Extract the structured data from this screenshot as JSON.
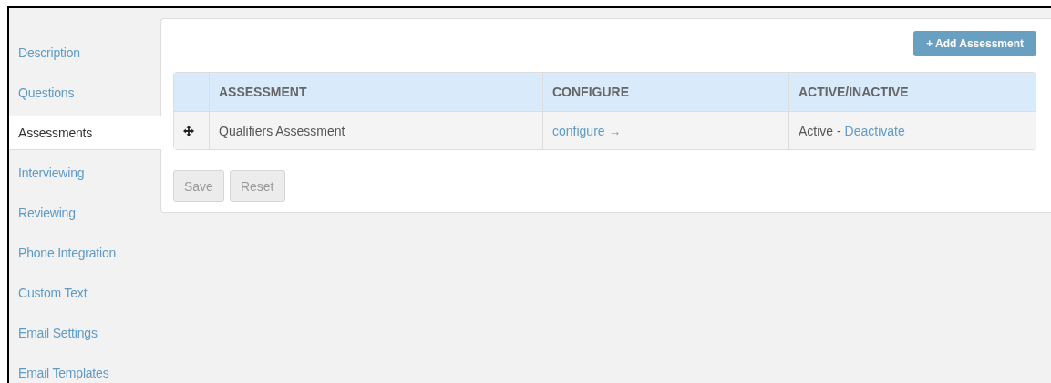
{
  "sidebar": {
    "items": [
      {
        "label": "Description",
        "selected": false
      },
      {
        "label": "Questions",
        "selected": false
      },
      {
        "label": "Assessments",
        "selected": true
      },
      {
        "label": "Interviewing",
        "selected": false
      },
      {
        "label": "Reviewing",
        "selected": false
      },
      {
        "label": "Phone Integration",
        "selected": false
      },
      {
        "label": "Custom Text",
        "selected": false
      },
      {
        "label": "Email Settings",
        "selected": false
      },
      {
        "label": "Email Templates",
        "selected": false
      }
    ]
  },
  "add_button": "+ Add Assessment",
  "table": {
    "columns": [
      "ASSESSMENT",
      "CONFIGURE",
      "ACTIVE/INACTIVE"
    ],
    "rows": [
      {
        "assessment": "Qualifiers Assessment",
        "configure_link": "configure →",
        "status": "Active -",
        "status_link": "Deactivate"
      }
    ]
  },
  "buttons": [
    {
      "label": "Save",
      "disabled": true
    },
    {
      "label": "Reset",
      "disabled": true
    }
  ]
}
